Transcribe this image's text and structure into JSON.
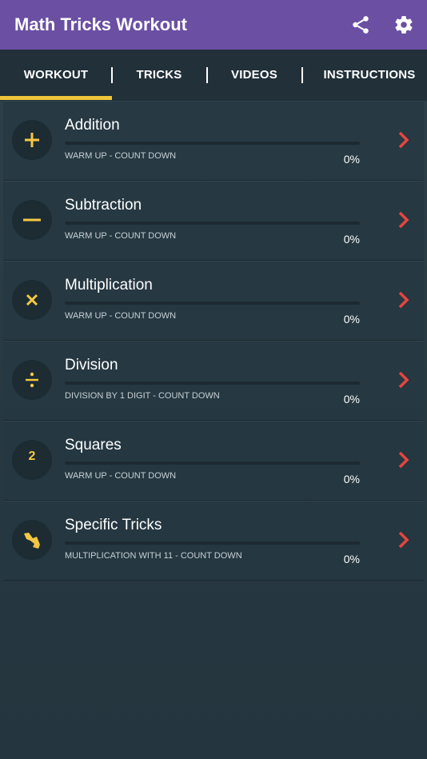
{
  "app": {
    "title": "Math Tricks Workout"
  },
  "colors": {
    "appbar": "#6a4fa3",
    "accent": "#f5c842",
    "chevron": "#e8453c",
    "tab_indicator": "#f0c43a"
  },
  "tabs": [
    {
      "label": "WORKOUT",
      "selected": true
    },
    {
      "label": "TRICKS",
      "selected": false
    },
    {
      "label": "VIDEOS",
      "selected": false
    },
    {
      "label": "INSTRUCTIONS",
      "selected": false
    }
  ],
  "items": [
    {
      "title": "Addition",
      "subtitle": "WARM UP - COUNT DOWN",
      "percent_label": "0%",
      "progress": 0,
      "icon": "plus-icon"
    },
    {
      "title": "Subtraction",
      "subtitle": "WARM UP - COUNT DOWN",
      "percent_label": "0%",
      "progress": 0,
      "icon": "minus-icon"
    },
    {
      "title": "Multiplication",
      "subtitle": "WARM UP - COUNT DOWN",
      "percent_label": "0%",
      "progress": 0,
      "icon": "times-icon"
    },
    {
      "title": "Division",
      "subtitle": "DIVISION BY 1 DIGIT - COUNT DOWN",
      "percent_label": "0%",
      "progress": 0,
      "icon": "divide-icon"
    },
    {
      "title": "Squares",
      "subtitle": "WARM UP - COUNT DOWN",
      "percent_label": "0%",
      "progress": 0,
      "icon": "squares-icon",
      "icon_text": "2"
    },
    {
      "title": "Specific Tricks",
      "subtitle": "MULTIPLICATION WITH 11 - COUNT DOWN",
      "percent_label": "0%",
      "progress": 0,
      "icon": "tricks-icon"
    }
  ]
}
